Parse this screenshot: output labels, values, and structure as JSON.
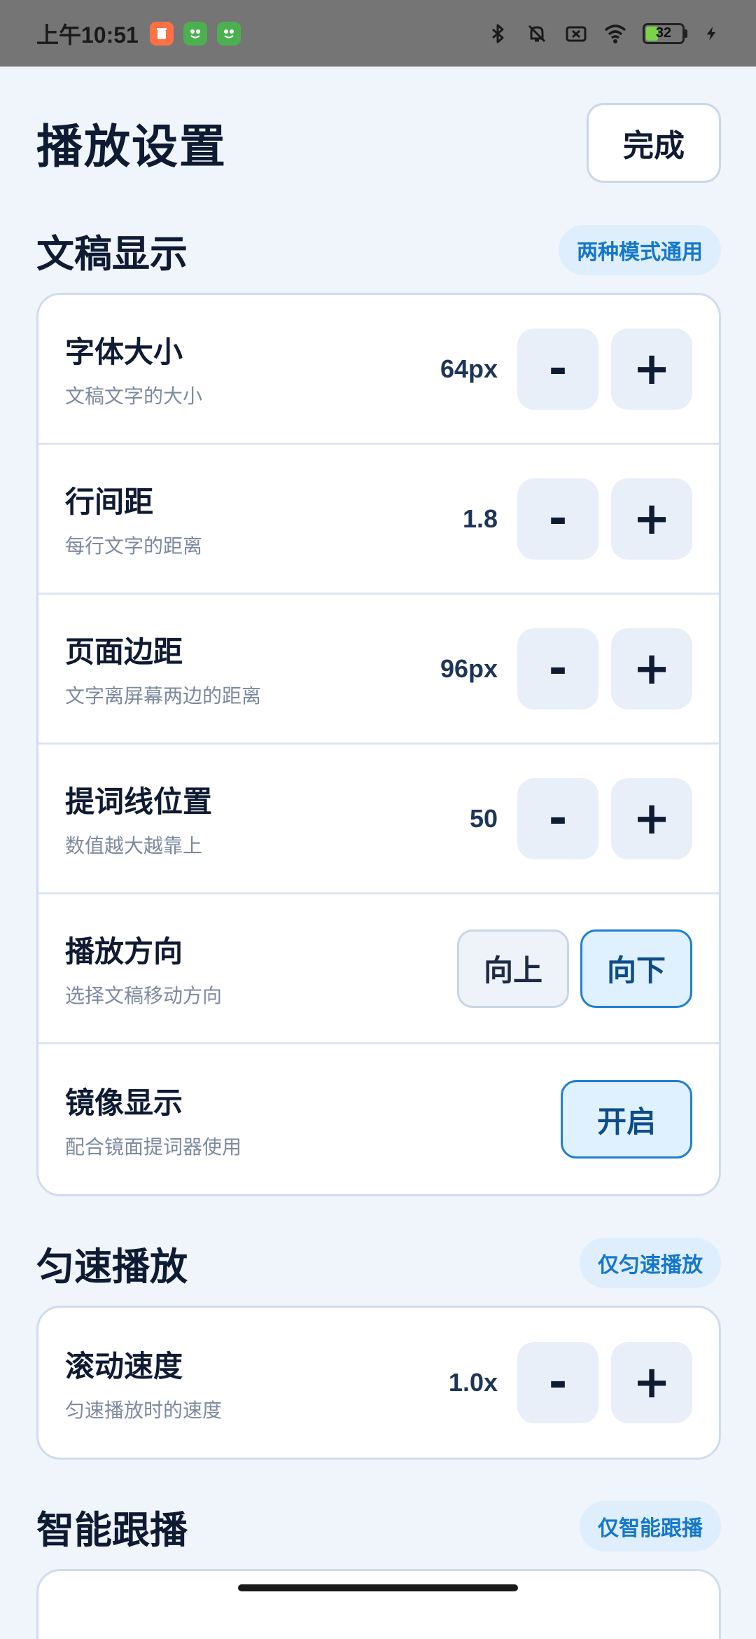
{
  "status_bar": {
    "time": "上午10:51",
    "battery": "32",
    "icons": [
      "trash-app-icon",
      "frog-app-icon",
      "frog-app-icon",
      "bluetooth-icon",
      "mute-icon",
      "sim-off-icon",
      "wifi-icon",
      "battery-icon",
      "charging-icon"
    ]
  },
  "header": {
    "title": "播放设置",
    "done_label": "完成"
  },
  "sections": {
    "display": {
      "title": "文稿显示",
      "badge": "两种模式通用",
      "rows": [
        {
          "title": "字体大小",
          "desc": "文稿文字的大小",
          "value": "64px"
        },
        {
          "title": "行间距",
          "desc": "每行文字的距离",
          "value": "1.8"
        },
        {
          "title": "页面边距",
          "desc": "文字离屏幕两边的距离",
          "value": "96px"
        },
        {
          "title": "提词线位置",
          "desc": "数值越大越靠上",
          "value": "50"
        },
        {
          "title": "播放方向",
          "desc": "选择文稿移动方向",
          "options": [
            "向上",
            "向下"
          ],
          "selected": "向下"
        },
        {
          "title": "镜像显示",
          "desc": "配合镜面提词器使用",
          "toggle": "开启"
        }
      ]
    },
    "constant": {
      "title": "匀速播放",
      "badge": "仅匀速播放",
      "rows": [
        {
          "title": "滚动速度",
          "desc": "匀速播放时的速度",
          "value": "1.0x"
        }
      ]
    },
    "smart": {
      "title": "智能跟播",
      "badge": "仅智能跟播"
    }
  },
  "stepper": {
    "minus": "-",
    "plus": "+"
  },
  "colors": {
    "accent": "#1f7fd0",
    "badge_bg": "#dfeefd",
    "page_bg": "#f0f5fb",
    "status_bar": "#757575"
  }
}
